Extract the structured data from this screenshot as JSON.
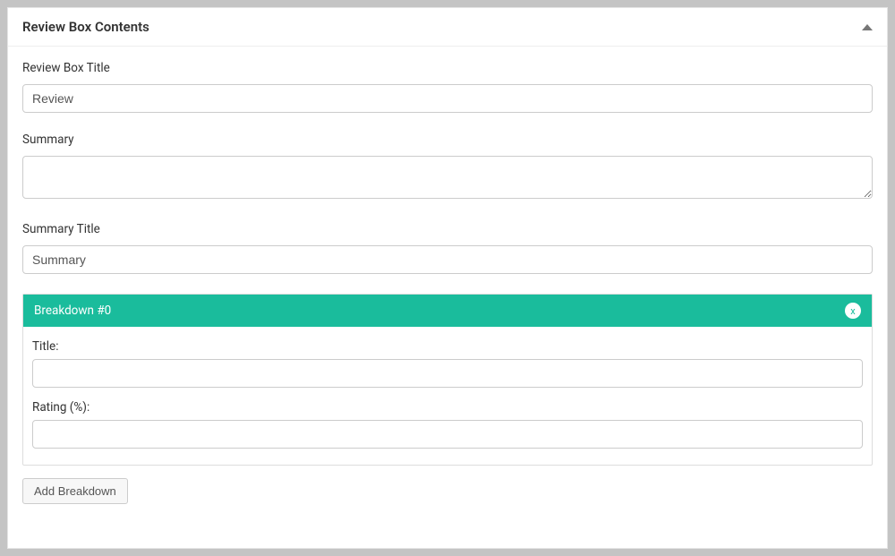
{
  "panel": {
    "title": "Review Box Contents"
  },
  "fields": {
    "review_box_title": {
      "label": "Review Box Title",
      "value": "Review"
    },
    "summary": {
      "label": "Summary",
      "value": ""
    },
    "summary_title": {
      "label": "Summary Title",
      "value": "Summary"
    }
  },
  "breakdowns": [
    {
      "header": "Breakdown #0",
      "close_label": "x",
      "title_label": "Title:",
      "title_value": "",
      "rating_label": "Rating (%):",
      "rating_value": ""
    }
  ],
  "buttons": {
    "add_breakdown": "Add Breakdown"
  }
}
